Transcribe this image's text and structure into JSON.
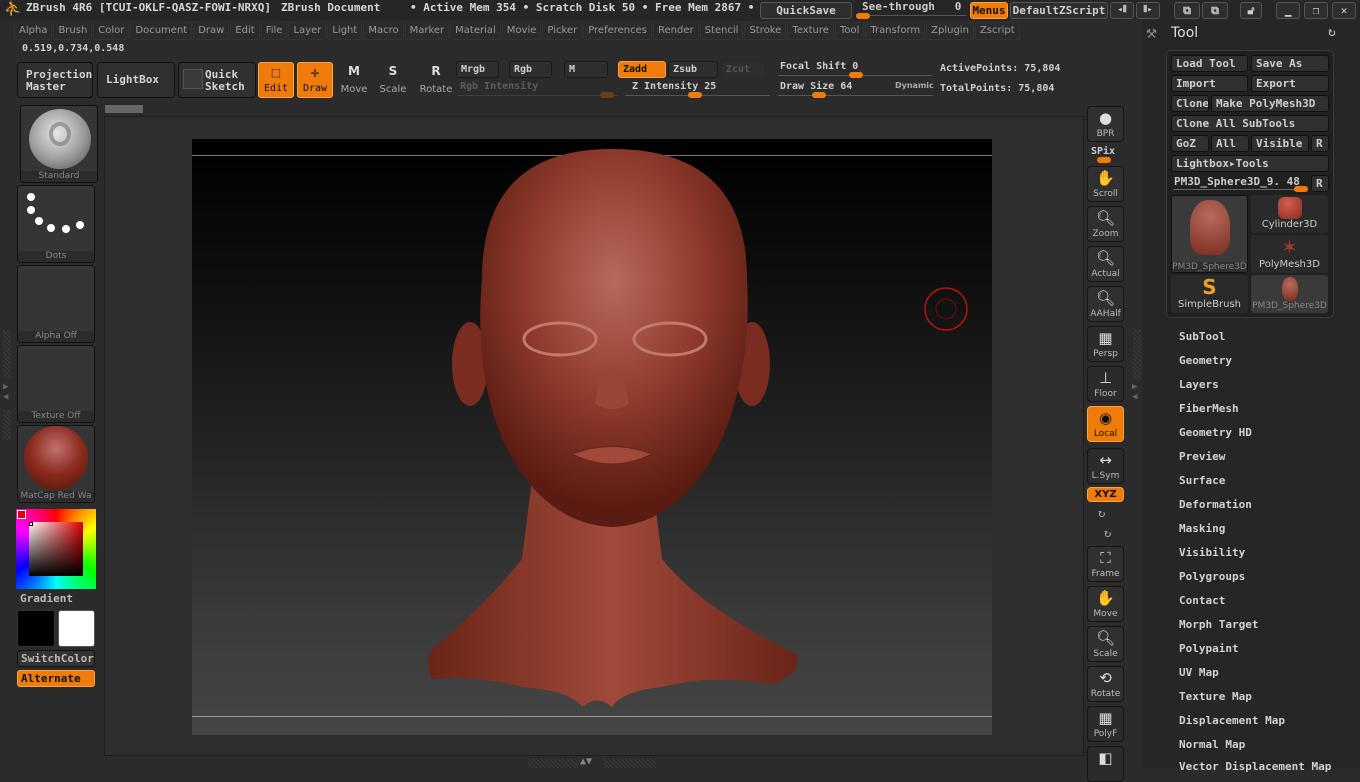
{
  "app": {
    "title": "ZBrush 4R6 [TCUI-OKLF-QASZ-FOWI-NRXQ]",
    "document": "ZBrush Document",
    "mem_status": "• Active Mem 354 • Scratch Disk 50 • Free Mem 2867 •",
    "quicksave": "QuickSave",
    "see_through_label": "See-through",
    "see_through_value": "0",
    "menus": "Menus",
    "default_zscript": "DefaultZScript"
  },
  "menubar": [
    "Alpha",
    "Brush",
    "Color",
    "Document",
    "Draw",
    "Edit",
    "File",
    "Layer",
    "Light",
    "Macro",
    "Marker",
    "Material",
    "Movie",
    "Picker",
    "Preferences",
    "Render",
    "Stencil",
    "Stroke",
    "Texture",
    "Tool",
    "Transform",
    "Zplugin",
    "Zscript"
  ],
  "coords": "0.519,0.734,0.548",
  "toolbar": {
    "projection_master": "Projection Master",
    "lightbox": "LightBox",
    "quick_sketch": "Quick Sketch",
    "edit": "Edit",
    "draw": "Draw",
    "move": "Move",
    "scale": "Scale",
    "rotate": "Rotate",
    "mrgb": "Mrgb",
    "rgb": "Rgb",
    "m": "M",
    "zadd": "Zadd",
    "zsub": "Zsub",
    "zcut": "Zcut",
    "rgb_intensity": "Rgb Intensity",
    "z_intensity_label": "Z Intensity",
    "z_intensity": "25",
    "focal_shift_label": "Focal Shift",
    "focal_shift": "0",
    "draw_size_label": "Draw Size",
    "draw_size": "64",
    "dynamic": "Dynamic",
    "active_points": "ActivePoints: 75,804",
    "total_points": "TotalPoints: 75,804"
  },
  "left_shelf": {
    "brush": "Standard",
    "stroke": "Dots",
    "alpha": "Alpha Off",
    "texture": "Texture Off",
    "material": "MatCap Red Wa",
    "gradient": "Gradient",
    "switch_color": "SwitchColor",
    "alternate": "Alternate"
  },
  "right_shelf": [
    "BPR",
    "SPix",
    "Scroll",
    "Zoom",
    "Actual",
    "AAHalf",
    "Persp",
    "Floor",
    "Local",
    "L.Sym",
    "XYZ",
    "Frame",
    "Move",
    "Scale",
    "Rotate",
    "PolyF"
  ],
  "tool_panel": {
    "title": "Tool",
    "load_tool": "Load Tool",
    "save_as": "Save As",
    "import": "Import",
    "export": "Export",
    "clone": "Clone",
    "make_polymesh": "Make PolyMesh3D",
    "clone_all": "Clone All SubTools",
    "goz": "GoZ",
    "all": "All",
    "visible": "Visible",
    "r": "R",
    "lightbox_tools": "Lightbox▸Tools",
    "current_tool": "PM3D_Sphere3D_9. 48",
    "thumbs": [
      "PM3D_Sphere3D",
      "Cylinder3D",
      "PolyMesh3D",
      "SimpleBrush",
      "PM3D_Sphere3D"
    ],
    "sections": [
      "SubTool",
      "Geometry",
      "Layers",
      "FiberMesh",
      "Geometry HD",
      "Preview",
      "Surface",
      "Deformation",
      "Masking",
      "Visibility",
      "Polygroups",
      "Contact",
      "Morph Target",
      "Polypaint",
      "UV Map",
      "Texture Map",
      "Displacement Map",
      "Normal Map",
      "Vector Displacement Map"
    ]
  },
  "colors": {
    "accent": "#ef7b0a",
    "model": "#8e3a2c",
    "cursor": "#c01010"
  }
}
